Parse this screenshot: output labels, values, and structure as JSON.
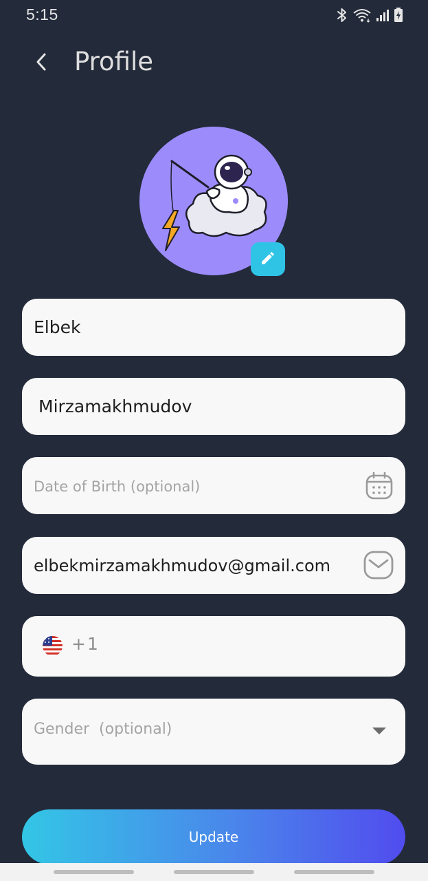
{
  "status_bar": {
    "time": "5:15",
    "icons": [
      "bluetooth-icon",
      "wifi-icon",
      "signal-icon",
      "battery-charging-icon"
    ]
  },
  "header": {
    "back_icon": "chevron-left-icon",
    "title": "Profile"
  },
  "avatar": {
    "image": "astronaut-fishing-illustration",
    "background_color": "#9C8CFB",
    "edit_icon": "pencil-icon",
    "edit_button_color": "#2FC3E6"
  },
  "form": {
    "first_name": {
      "value": "Elbek"
    },
    "last_name": {
      "value": "Mirzamakhmudov"
    },
    "date_of_birth": {
      "value": "",
      "placeholder": "Date of Birth (optional)",
      "icon": "calendar-icon"
    },
    "email": {
      "value": "elbekmirzamakhmudov@gmail.com",
      "icon": "mail-icon"
    },
    "phone": {
      "flag": "us-flag-icon",
      "code": "+1",
      "value": ""
    },
    "gender": {
      "value": "Gender  (optional)",
      "icon": "dropdown-arrow-icon"
    }
  },
  "update_button": {
    "label": "Update",
    "gradient": [
      "#33C6E6",
      "#514CEE"
    ]
  },
  "colors": {
    "background": "#232A3A",
    "field_background": "#F8F8F8"
  }
}
